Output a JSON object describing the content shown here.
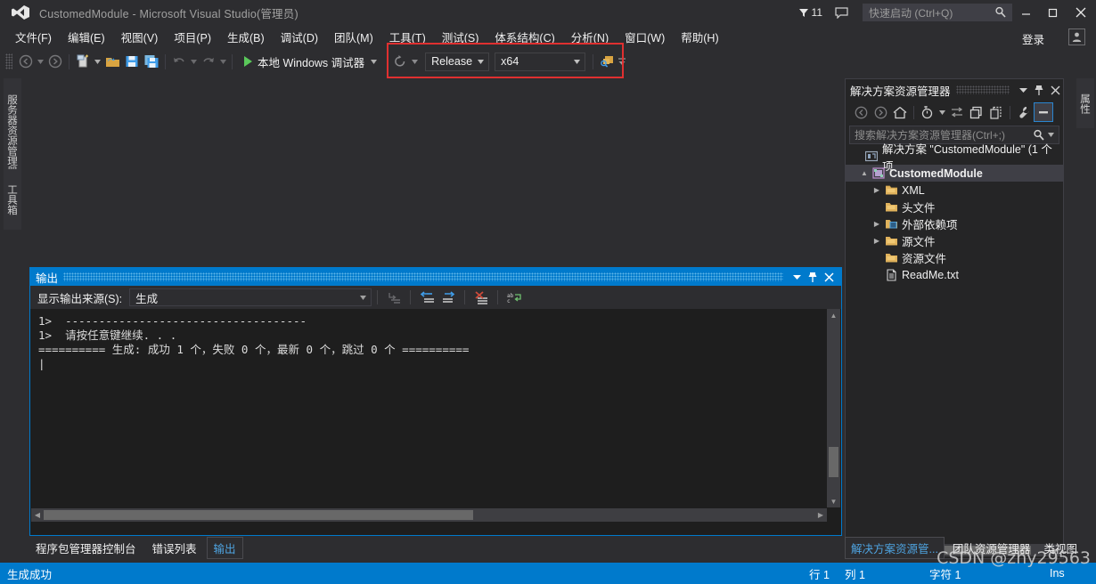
{
  "window": {
    "title": "CustomedModule - Microsoft Visual Studio(管理员)",
    "logo_icon": "visual-studio-logo-icon",
    "minimize_icon": "minimize-icon",
    "maximize_icon": "maximize-icon",
    "close_icon": "close-icon",
    "notification_count": "11",
    "notification_icon": "notification-funnel-icon",
    "feedback_icon": "feedback-bubble-icon",
    "quick_launch": {
      "placeholder": "快速启动 (Ctrl+Q)",
      "value": "",
      "icon": "search-icon"
    },
    "signin_label": "登录",
    "account_icon": "user-account-icon"
  },
  "menubar": {
    "items": [
      {
        "label": "文件(F)",
        "key": "F"
      },
      {
        "label": "编辑(E)",
        "key": "E"
      },
      {
        "label": "视图(V)",
        "key": "V"
      },
      {
        "label": "项目(P)",
        "key": "P"
      },
      {
        "label": "生成(B)",
        "key": "B"
      },
      {
        "label": "调试(D)",
        "key": "D"
      },
      {
        "label": "团队(M)",
        "key": "M"
      },
      {
        "label": "工具(T)",
        "key": "T"
      },
      {
        "label": "测试(S)",
        "key": "S"
      },
      {
        "label": "体系结构(C)",
        "key": "C"
      },
      {
        "label": "分析(N)",
        "key": "N"
      },
      {
        "label": "窗口(W)",
        "key": "W"
      },
      {
        "label": "帮助(H)",
        "key": "H"
      }
    ]
  },
  "toolbar": {
    "nav_back_icon": "navigate-back-icon",
    "nav_forward_icon": "navigate-forward-icon",
    "new_item_icon": "new-item-icon",
    "open_file_icon": "open-file-icon",
    "save_icon": "save-icon",
    "save_all_icon": "save-all-icon",
    "undo_icon": "undo-icon",
    "redo_icon": "redo-icon",
    "start_debug_label": "本地 Windows 调试器",
    "start_debug_icon": "start-play-icon",
    "restart_icon": "restart-circular-arrow-icon",
    "configuration": {
      "value": "Release",
      "name": "solution-configuration"
    },
    "platform": {
      "value": "x64",
      "name": "solution-platform"
    },
    "find_icon": "find-in-files-icon",
    "overflow_icon": "toolbar-overflow-icon",
    "highlight_color": "#e03030"
  },
  "left_tool_tabs": [
    {
      "label": "服务器资源管理器"
    },
    {
      "label": "工具箱"
    }
  ],
  "right_tool_tabs": [
    {
      "label": "属性"
    }
  ],
  "solution_explorer": {
    "title": "解决方案资源管理器",
    "header_buttons": [
      {
        "icon": "chevron-down-icon"
      },
      {
        "icon": "pin-icon"
      },
      {
        "icon": "close-icon"
      }
    ],
    "toolbar_icons": [
      "back-arrow-icon",
      "forward-arrow-icon",
      "home-icon",
      "pending-changes-filter-icon",
      "sync-with-active-document-icon",
      "refresh-icon",
      "show-all-files-icon",
      "properties-wrench-icon",
      "collapse-all-icon"
    ],
    "search": {
      "placeholder": "搜索解决方案资源管理器(Ctrl+;)",
      "value": "",
      "icon": "search-icon",
      "dropdown_icon": "chevron-down-icon"
    },
    "tree": [
      {
        "label": "解决方案 \"CustomedModule\" (1 个项",
        "icon": "solution-icon",
        "indent": 0,
        "expandable": false,
        "expanded": false,
        "selected": false,
        "bold": false
      },
      {
        "label": "CustomedModule",
        "icon": "cpp-project-icon",
        "indent": 1,
        "expandable": true,
        "expanded": true,
        "selected": true,
        "bold": true
      },
      {
        "label": "XML",
        "icon": "folder-icon",
        "indent": 2,
        "expandable": true,
        "expanded": false,
        "selected": false,
        "bold": false
      },
      {
        "label": "头文件",
        "icon": "folder-icon",
        "indent": 2,
        "expandable": false,
        "expanded": false,
        "selected": false,
        "bold": false
      },
      {
        "label": "外部依赖项",
        "icon": "external-dependencies-icon",
        "indent": 2,
        "expandable": true,
        "expanded": false,
        "selected": false,
        "bold": false
      },
      {
        "label": "源文件",
        "icon": "folder-icon",
        "indent": 2,
        "expandable": true,
        "expanded": false,
        "selected": false,
        "bold": false
      },
      {
        "label": "资源文件",
        "icon": "folder-icon",
        "indent": 2,
        "expandable": false,
        "expanded": false,
        "selected": false,
        "bold": false
      },
      {
        "label": "ReadMe.txt",
        "icon": "text-file-icon",
        "indent": 2,
        "expandable": false,
        "expanded": false,
        "selected": false,
        "bold": false
      }
    ]
  },
  "output_panel": {
    "title": "输出",
    "header_buttons": [
      {
        "icon": "chevron-down-icon"
      },
      {
        "icon": "pin-icon"
      },
      {
        "icon": "close-icon"
      }
    ],
    "source_label": "显示输出来源(S):",
    "source_value": "生成",
    "toolbar_icons": [
      "find-message-in-code-icon",
      "go-to-previous-message-icon",
      "go-to-next-message-icon",
      "clear-all-icon",
      "toggle-word-wrap-icon"
    ],
    "lines": [
      "1>  ------------------------------------",
      "1>  请按任意键继续. . .",
      "========== 生成: 成功 1 个，失败 0 个，最新 0 个，跳过 0 个 ==========",
      ""
    ]
  },
  "bottom_tabs": [
    {
      "label": "程序包管理器控制台",
      "selected": false
    },
    {
      "label": "错误列表",
      "selected": false
    },
    {
      "label": "输出",
      "selected": true
    }
  ],
  "right_bottom_tabs": [
    {
      "label": "解决方案资源管...",
      "selected": true
    },
    {
      "label": "团队资源管理器",
      "selected": false
    },
    {
      "label": "类视图",
      "selected": false
    }
  ],
  "statusbar": {
    "message": "生成成功",
    "line": "行 1",
    "column": "列 1",
    "character": "字符 1",
    "insert_mode": "Ins",
    "background_color": "#007acc"
  },
  "watermark": "CSDN @zhy29563"
}
